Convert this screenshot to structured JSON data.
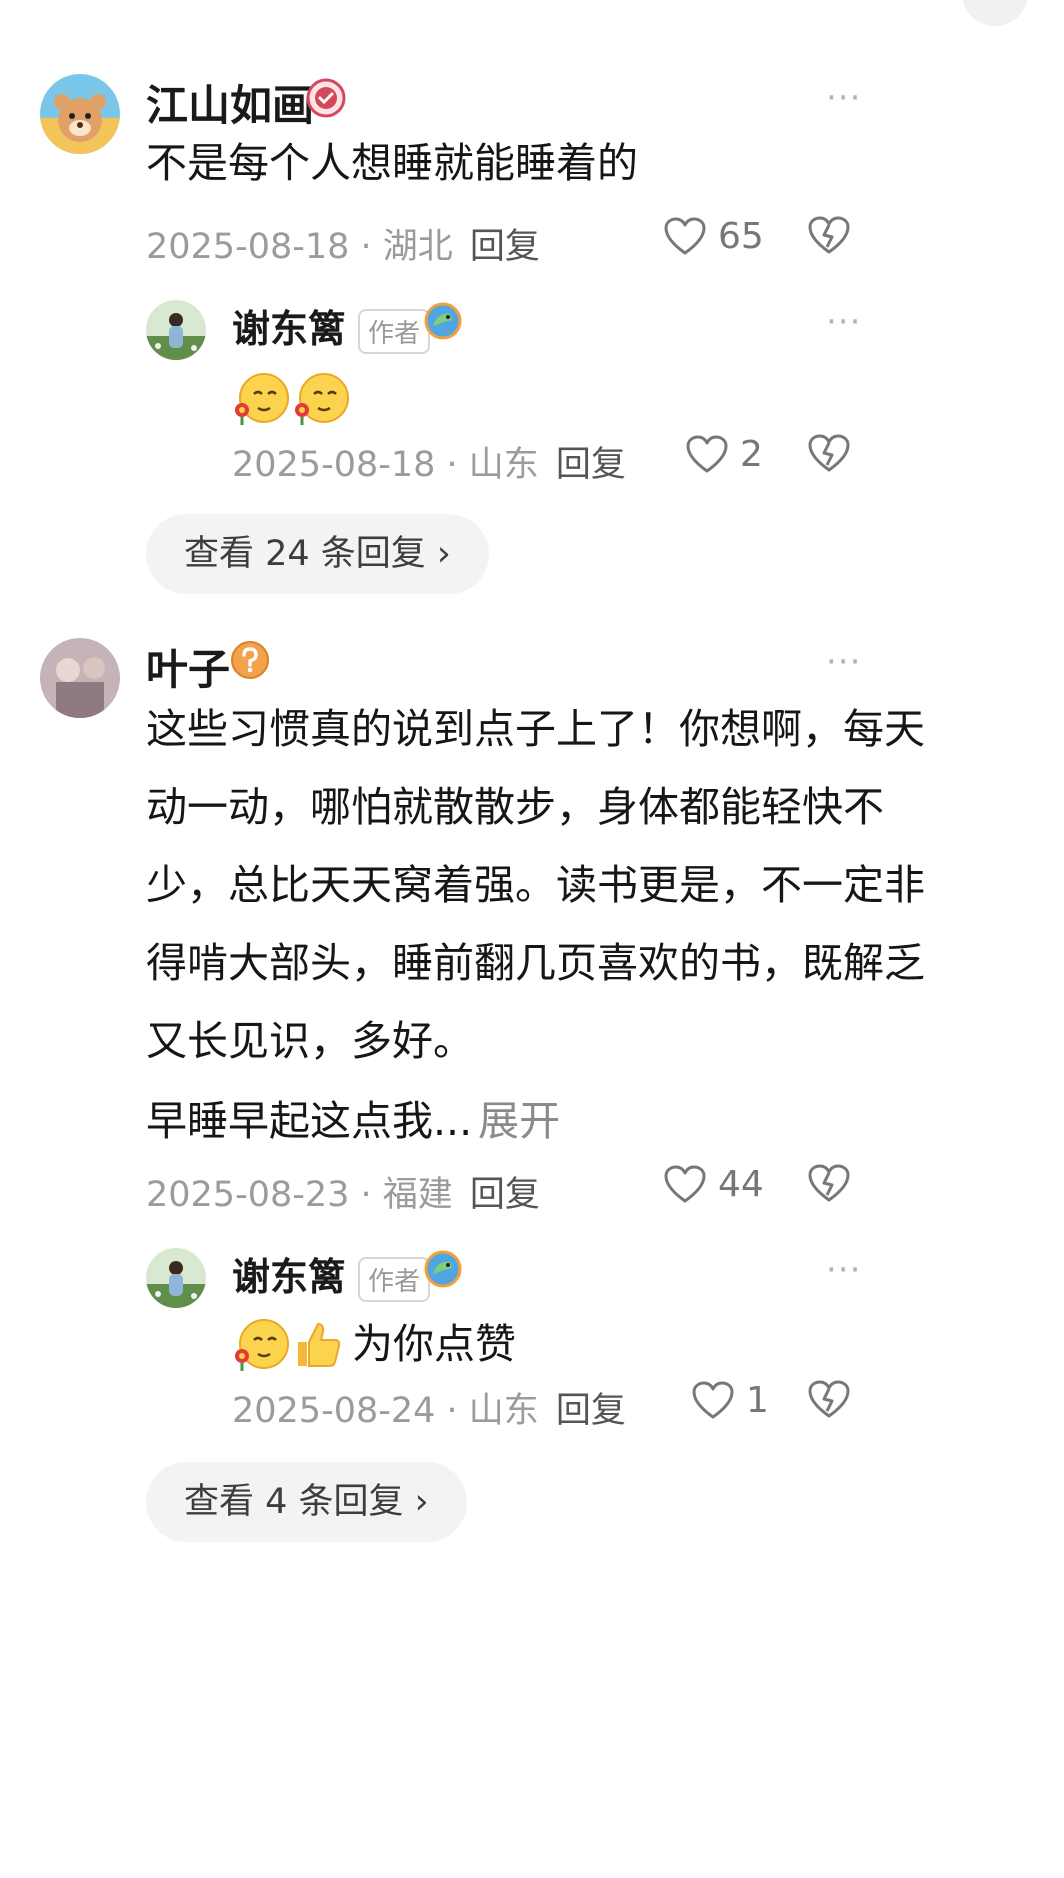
{
  "header": {
    "partial_text": "· · ·  ·  ·     · ·  · ·"
  },
  "comments": [
    {
      "author": "江山如画",
      "text": "不是每个人想睡就能睡着的",
      "meta": "2025-08-18 · 湖北",
      "reply_label": "回复",
      "likes": "65",
      "more": "···",
      "reply": {
        "author": "谢东篱",
        "badge": "作者",
        "text": "",
        "meta": "2025-08-18 · 山东",
        "reply_label": "回复",
        "likes": "2",
        "more": "···"
      },
      "view_replies": "查看 24 条回复 ›"
    },
    {
      "author": "叶子",
      "text_lines": [
        "这些习惯真的说到点子上了！你想啊，每天",
        "动一动，哪怕就散散步，身体都能轻快不",
        "少，总比天天窝着强。读书更是，不一定非",
        "得啃大部头，睡前翻几页喜欢的书，既解乏",
        "又长见识，多好。"
      ],
      "text_tail": "早睡早起这点我...",
      "expand_label": "展开",
      "meta": "2025-08-23 · 福建",
      "reply_label": "回复",
      "likes": "44",
      "more": "···",
      "reply": {
        "author": "谢东篱",
        "badge": "作者",
        "text": "为你点赞",
        "meta": "2025-08-24 · 山东",
        "reply_label": "回复",
        "likes": "1",
        "more": "···"
      },
      "view_replies": "查看 4 条回复 ›"
    }
  ],
  "icons": {
    "like": "heart-outline-icon",
    "dislike": "broken-heart-icon",
    "verified": "verified-check-icon",
    "unknown": "question-mark-icon",
    "fan": "dragon-fan-badge-icon"
  }
}
